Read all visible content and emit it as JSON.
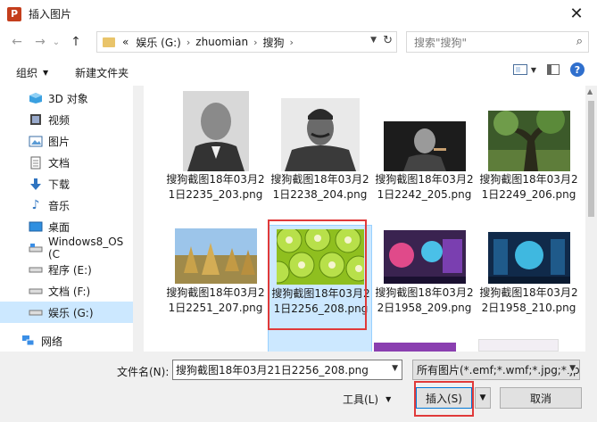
{
  "window": {
    "title": "插入图片",
    "app_icon_letter": "P",
    "close_glyph": "✕"
  },
  "nav": {
    "back": "←",
    "forward": "→",
    "history": "⌄",
    "up": "↑",
    "address": {
      "prefix": "«",
      "segments": [
        "娱乐 (G:)",
        "zhuomian",
        "搜狗"
      ]
    },
    "search_placeholder": "搜索\"搜狗\""
  },
  "toolbar": {
    "organize_label": "组织",
    "new_folder_label": "新建文件夹",
    "help_glyph": "?"
  },
  "sidebar": {
    "items": [
      {
        "label": "3D 对象",
        "icon": "3d-objects-icon"
      },
      {
        "label": "视频",
        "icon": "video-icon"
      },
      {
        "label": "图片",
        "icon": "pictures-icon"
      },
      {
        "label": "文档",
        "icon": "documents-icon"
      },
      {
        "label": "下载",
        "icon": "download-icon"
      },
      {
        "label": "音乐",
        "icon": "music-icon"
      },
      {
        "label": "桌面",
        "icon": "desktop-icon"
      },
      {
        "label": "Windows8_OS (C",
        "icon": "drive-icon"
      },
      {
        "label": "程序 (E:)",
        "icon": "drive-icon"
      },
      {
        "label": "文档 (F:)",
        "icon": "drive-icon"
      },
      {
        "label": "娱乐 (G:)",
        "icon": "drive-icon",
        "selected": true
      },
      {
        "label": "网络",
        "icon": "network-icon"
      }
    ]
  },
  "files": [
    {
      "name": "搜狗截图18年03月21日2235_203.png",
      "thumb": "portrait-man-suit"
    },
    {
      "name": "搜狗截图18年03月21日2238_204.png",
      "thumb": "portrait-man-uniform"
    },
    {
      "name": "搜狗截图18年03月21日2242_205.png",
      "thumb": "portrait-man-cigar"
    },
    {
      "name": "搜狗截图18年03月21日2249_206.png",
      "thumb": "forest-tree"
    },
    {
      "name": "搜狗截图18年03月21日2251_207.png",
      "thumb": "haystacks-field"
    },
    {
      "name": "搜狗截图18年03月21日2256_208.png",
      "thumb": "kiwi-slices",
      "selected": true
    },
    {
      "name": "搜狗截图18年03月22日1958_209.png",
      "thumb": "game-scene-1"
    },
    {
      "name": "搜狗截图18年03月22日1958_210.png",
      "thumb": "game-scene-2"
    }
  ],
  "bottom": {
    "filename_label": "文件名(N):",
    "filename_value": "搜狗截图18年03月21日2256_208.png",
    "filetype_value": "所有图片(*.emf;*.wmf;*.jpg;*.jpeg;*.jfif",
    "tools_label": "工具(L)",
    "insert_label": "插入(S)",
    "cancel_label": "取消"
  },
  "colors": {
    "selection": "#cce8ff",
    "accent_border": "#0078d7",
    "highlight_box": "#e03a3a"
  }
}
